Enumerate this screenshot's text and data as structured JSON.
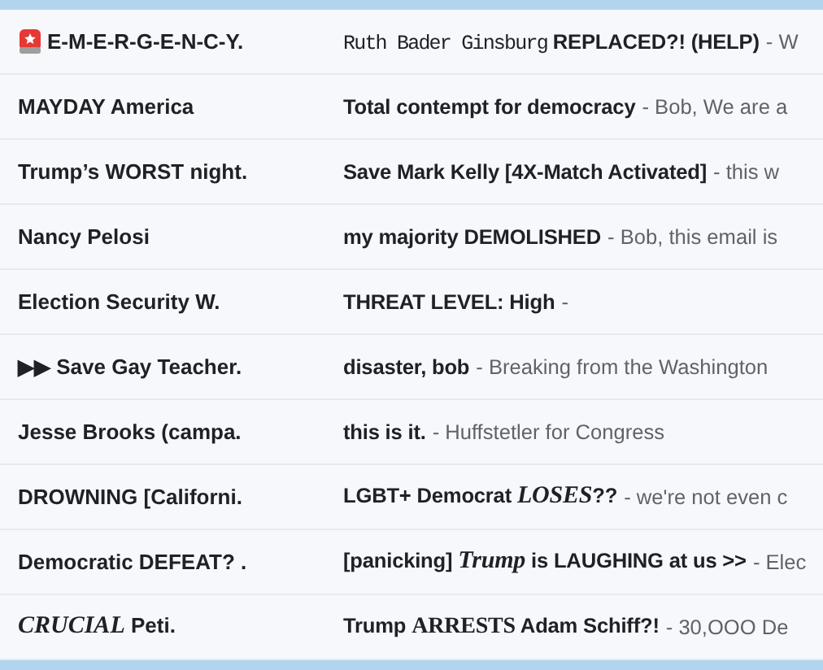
{
  "messages": [
    {
      "urgent": true,
      "sender": [
        {
          "kind": "plain",
          "text": "E-M-E-R-G-E-N-C-Y."
        }
      ],
      "subject": [
        {
          "kind": "mono",
          "text": "Ruth Bader Ginsburg"
        },
        {
          "kind": "plain",
          "text": " REPLACED?! (HELP)"
        }
      ],
      "snippet": "- W"
    },
    {
      "sender": [
        {
          "kind": "plain",
          "text": "MAYDAY America"
        }
      ],
      "subject": [
        {
          "kind": "plain",
          "text": "Total contempt for democracy"
        }
      ],
      "snippet": "- Bob, We are a"
    },
    {
      "sender": [
        {
          "kind": "plain",
          "text": "Trump’s WORST night."
        }
      ],
      "subject": [
        {
          "kind": "plain",
          "text": "Save Mark Kelly [4X-Match Activated]"
        }
      ],
      "snippet": "- this w"
    },
    {
      "sender": [
        {
          "kind": "plain",
          "text": "Nancy Pelosi"
        }
      ],
      "subject": [
        {
          "kind": "plain",
          "text": "my majority DEMOLISHED"
        }
      ],
      "snippet": "- Bob, this email is"
    },
    {
      "sender": [
        {
          "kind": "plain",
          "text": "Election Security W."
        }
      ],
      "subject": [
        {
          "kind": "plain",
          "text": "THREAT LEVEL: High"
        }
      ],
      "snippet": "-"
    },
    {
      "sender": [
        {
          "kind": "plain",
          "text": "▶▶ Save Gay Teacher."
        }
      ],
      "subject": [
        {
          "kind": "plain",
          "text": "disaster, bob"
        }
      ],
      "snippet": "- Breaking from the Washington"
    },
    {
      "sender": [
        {
          "kind": "plain",
          "text": "Jesse Brooks (campa."
        }
      ],
      "subject": [
        {
          "kind": "plain",
          "text": "this is it."
        }
      ],
      "snippet": "- Huffstetler for Congress"
    },
    {
      "sender": [
        {
          "kind": "plain",
          "text": "DROWNING [Californi."
        }
      ],
      "subject": [
        {
          "kind": "plain",
          "text": "LGBT+ Democrat "
        },
        {
          "kind": "serif-italic",
          "text": "LOSES"
        },
        {
          "kind": "plain",
          "text": "??"
        }
      ],
      "snippet": "- we're not even c"
    },
    {
      "sender": [
        {
          "kind": "plain",
          "text": "Democratic DEFEAT? ."
        }
      ],
      "subject": [
        {
          "kind": "plain",
          "text": "[panicking] "
        },
        {
          "kind": "serif-italic",
          "text": "Trump"
        },
        {
          "kind": "plain",
          "text": " is LAUGHING at us >>"
        }
      ],
      "snippet": "- Elec"
    },
    {
      "sender": [
        {
          "kind": "serif-italic",
          "text": "CRUCIAL"
        },
        {
          "kind": "plain",
          "text": " Peti."
        }
      ],
      "subject": [
        {
          "kind": "plain",
          "text": "Trump "
        },
        {
          "kind": "serif",
          "text": "ARRESTS"
        },
        {
          "kind": "plain",
          "text": " Adam Schiff?!"
        }
      ],
      "snippet": "- 30,OOO De"
    }
  ]
}
